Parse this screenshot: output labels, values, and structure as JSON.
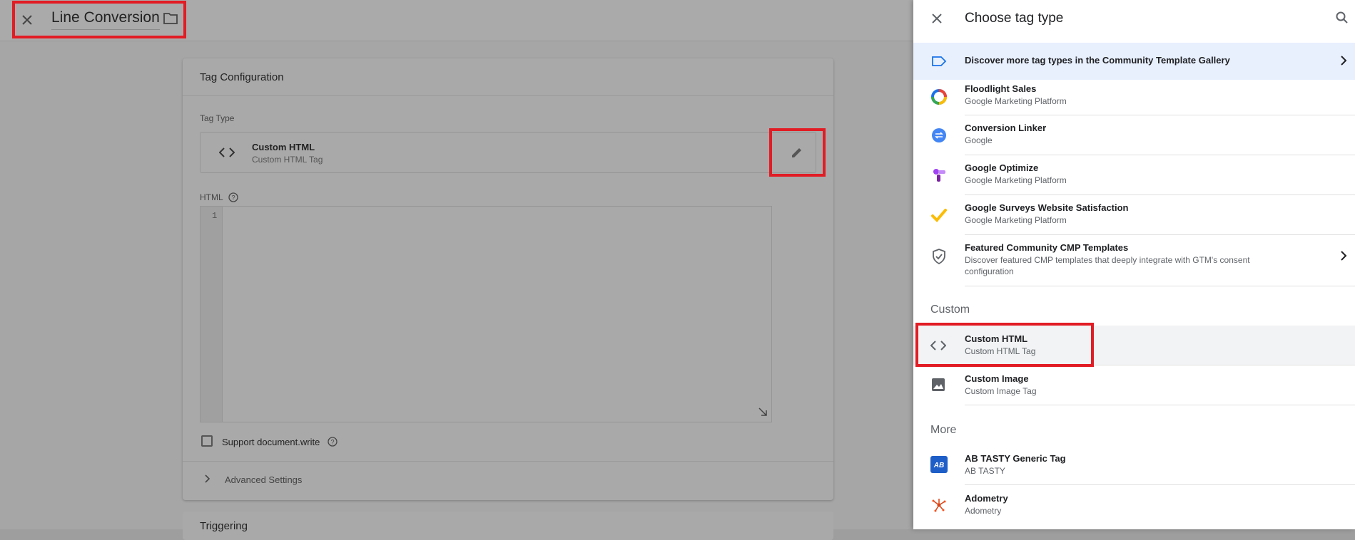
{
  "editor": {
    "title": "Line Conversion",
    "card": {
      "title": "Tag Configuration",
      "tag_type_label": "Tag Type",
      "tag_type_name": "Custom HTML",
      "tag_type_sub": "Custom HTML Tag",
      "html_label": "HTML",
      "line_number": "1",
      "support_label": "Support document.write",
      "advanced_label": "Advanced Settings"
    },
    "next_card_title": "Triggering"
  },
  "drawer": {
    "title": "Choose tag type",
    "discover": "Discover more tag types in the Community Template Gallery",
    "items_top": [
      {
        "name": "Floodlight Sales",
        "sub": "Google Marketing Platform",
        "icon": "floodlight-icon"
      },
      {
        "name": "Conversion Linker",
        "sub": "Google",
        "icon": "conversion-linker-icon"
      },
      {
        "name": "Google Optimize",
        "sub": "Google Marketing Platform",
        "icon": "optimize-icon"
      },
      {
        "name": "Google Surveys Website Satisfaction",
        "sub": "Google Marketing Platform",
        "icon": "surveys-icon"
      },
      {
        "name": "Featured Community CMP Templates",
        "sub": "Discover featured CMP templates that deeply integrate with GTM's consent configuration",
        "icon": "shield-check-icon"
      }
    ],
    "section_custom": "Custom",
    "custom_items": [
      {
        "name": "Custom HTML",
        "sub": "Custom HTML Tag",
        "icon": "code-icon"
      },
      {
        "name": "Custom Image",
        "sub": "Custom Image Tag",
        "icon": "image-icon"
      }
    ],
    "section_more": "More",
    "more_items": [
      {
        "name": "AB TASTY Generic Tag",
        "sub": "AB TASTY",
        "icon": "abtasty-icon"
      },
      {
        "name": "Adometry",
        "sub": "Adometry",
        "icon": "adometry-icon"
      }
    ]
  },
  "colors": {
    "highlight": "#e21c24",
    "discover_bg": "#e8f0fe",
    "selected_bg": "#f1f3f4"
  }
}
